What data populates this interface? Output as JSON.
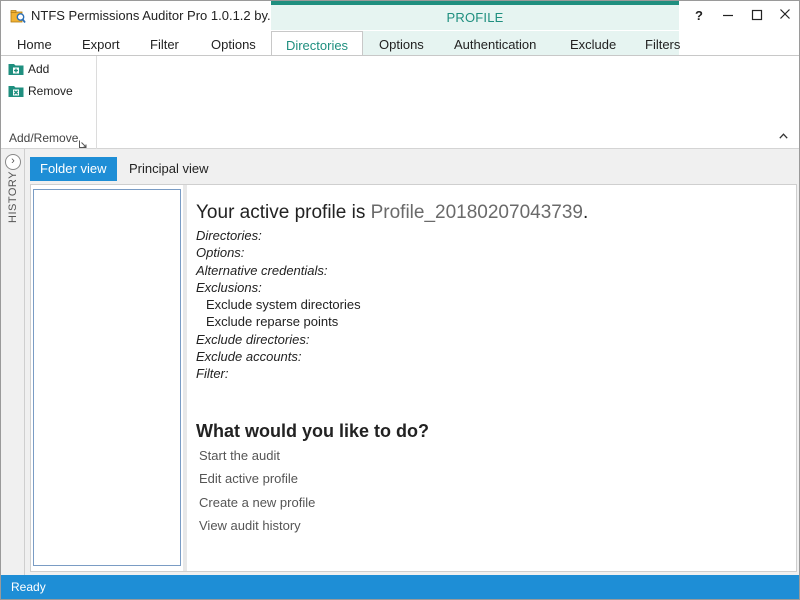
{
  "window": {
    "title": "NTFS Permissions Auditor Pro 1.0.1.2 by...",
    "context_tab_group": "PROFILE",
    "help_label": "?",
    "minimize_label": "—",
    "maximize_label": "☐",
    "close_label": "✕"
  },
  "ribbon": {
    "tabs": [
      {
        "label": "Home"
      },
      {
        "label": "Export"
      },
      {
        "label": "Filter"
      },
      {
        "label": "Options"
      }
    ],
    "context_tabs": [
      {
        "label": "Directories"
      },
      {
        "label": "Options"
      },
      {
        "label": "Authentication"
      },
      {
        "label": "Exclude"
      },
      {
        "label": "Filters"
      }
    ],
    "active_tab": "Directories",
    "group": {
      "label": "Add/Remove",
      "items": [
        {
          "label": "Add",
          "icon": "folder-add-icon"
        },
        {
          "label": "Remove",
          "icon": "folder-remove-icon"
        }
      ]
    },
    "collapse_label": "˄"
  },
  "history": {
    "label": "HISTORY",
    "toggle": "›"
  },
  "views": {
    "tabs": [
      {
        "label": "Folder view",
        "active": true
      },
      {
        "label": "Principal view",
        "active": false
      }
    ]
  },
  "profile": {
    "prefix": "Your active profile is ",
    "name": "Profile_20180207043739",
    "suffix": ".",
    "fields": {
      "directories": "Directories:",
      "options": "Options:",
      "alt_credentials": "Alternative credentials:",
      "exclusions": "Exclusions:",
      "exclusion_items": [
        "Exclude system directories",
        "Exclude reparse points"
      ],
      "exclude_directories": "Exclude directories:",
      "exclude_accounts": "Exclude accounts:",
      "filter": "Filter:"
    }
  },
  "actions": {
    "heading": "What would you like to do?",
    "items": [
      {
        "label": "Start the audit"
      },
      {
        "label": "Edit active profile"
      },
      {
        "label": "Create a new profile"
      },
      {
        "label": "View audit history"
      }
    ]
  },
  "status": {
    "text": "Ready"
  },
  "colors": {
    "accent_blue": "#1e8ed6",
    "context_teal": "#1f8f7f",
    "context_bg": "#e6f4f1"
  }
}
